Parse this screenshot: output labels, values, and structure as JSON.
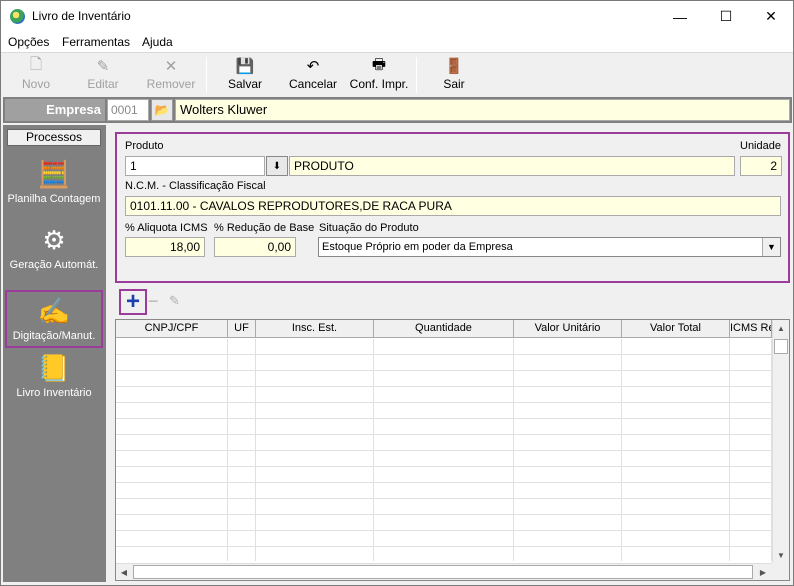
{
  "window": {
    "title": "Livro de Inventário",
    "minimize": "—",
    "maximize": "☐",
    "close": "✕"
  },
  "menu": [
    {
      "label": "Opções"
    },
    {
      "label": "Ferramentas"
    },
    {
      "label": "Ajuda"
    }
  ],
  "toolbar": {
    "novo": {
      "label": "Novo",
      "icon": "new-document-icon",
      "glyph": "🗋"
    },
    "editar": {
      "label": "Editar",
      "icon": "edit-icon",
      "glyph": "✎"
    },
    "remover": {
      "label": "Remover",
      "icon": "remove-icon",
      "glyph": "✕"
    },
    "salvar": {
      "label": "Salvar",
      "icon": "save-icon",
      "glyph": "💾"
    },
    "cancelar": {
      "label": "Cancelar",
      "icon": "undo-icon",
      "glyph": "↶"
    },
    "conf_impr": {
      "label": "Conf. Impr.",
      "icon": "printer-config-icon",
      "glyph": "🖶"
    },
    "sair": {
      "label": "Sair",
      "icon": "exit-door-icon",
      "glyph": "🚪"
    }
  },
  "empresa": {
    "label": "Empresa",
    "code": "0001",
    "name": "Wolters Kluwer",
    "folder_glyph": "📂"
  },
  "sidebar": {
    "header": "Processos",
    "items": [
      {
        "label": "Planilha Contagem",
        "glyph": "🧮"
      },
      {
        "label": "Geração Automát.",
        "glyph": "⚙"
      },
      {
        "label": "Digitação/Manut.",
        "glyph": "✍"
      },
      {
        "label": "Livro Inventário",
        "glyph": "📒"
      }
    ]
  },
  "form": {
    "produto_label": "Produto",
    "produto_code": "1",
    "produto_btn": "⬇",
    "produto_desc": "PRODUTO",
    "unidade_label": "Unidade",
    "unidade_value": "2",
    "ncm_label": "N.C.M. - Classificação Fiscal",
    "ncm_value": "0101.11.00 - CAVALOS REPRODUTORES,DE RACA PURA",
    "icms_label": "% Aliquota ICMS",
    "icms_value": "18,00",
    "reducao_label": "% Redução de Base",
    "reducao_value": "0,00",
    "situacao_label": "Situação do Produto",
    "situacao_value": "Estoque Próprio em poder da Empresa",
    "arrow": "▼"
  },
  "grid_tools": {
    "add": "+",
    "remove": "−",
    "edit": "✎"
  },
  "grid": {
    "columns": [
      "CNPJ/CPF",
      "UF",
      "Insc. Est.",
      "Quantidade",
      "Valor Unitário",
      "Valor Total",
      "ICMS Re"
    ],
    "scroll_up": "▲",
    "scroll_down": "▼",
    "scroll_left": "◀",
    "scroll_right": "▶"
  }
}
